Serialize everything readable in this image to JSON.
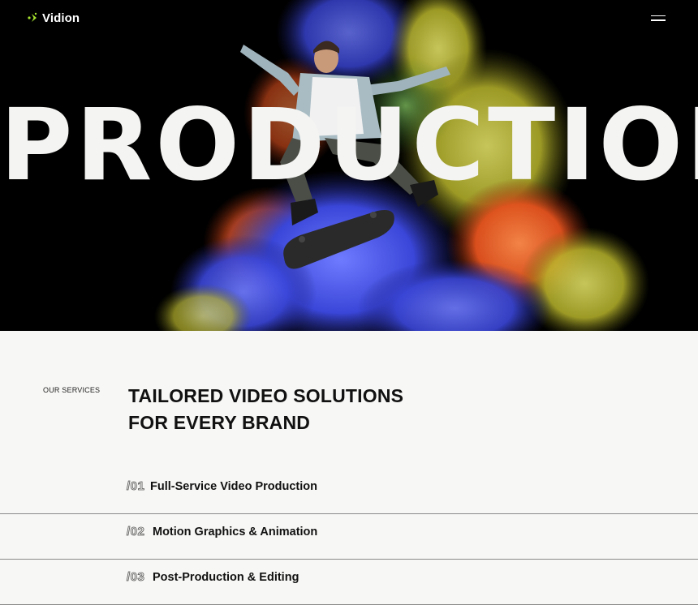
{
  "brand": {
    "name": "Vidion",
    "accent": "#a6e22e"
  },
  "header": {
    "menu_icon": "hamburger-icon"
  },
  "hero": {
    "title": "PRODUCTION"
  },
  "services": {
    "eyebrow": "OUR SERVICES",
    "title_line1": "TAILORED VIDEO SOLUTIONS",
    "title_line2": "FOR EVERY BRAND",
    "items": [
      {
        "num": "/01",
        "label": "Full-Service Video Production"
      },
      {
        "num": "/02",
        "label": "Motion Graphics & Animation"
      },
      {
        "num": "/03",
        "label": "Post-Production & Editing"
      }
    ]
  },
  "colors": {
    "background": "#f7f7f5",
    "hero_bg": "#000000",
    "text": "#111111"
  }
}
